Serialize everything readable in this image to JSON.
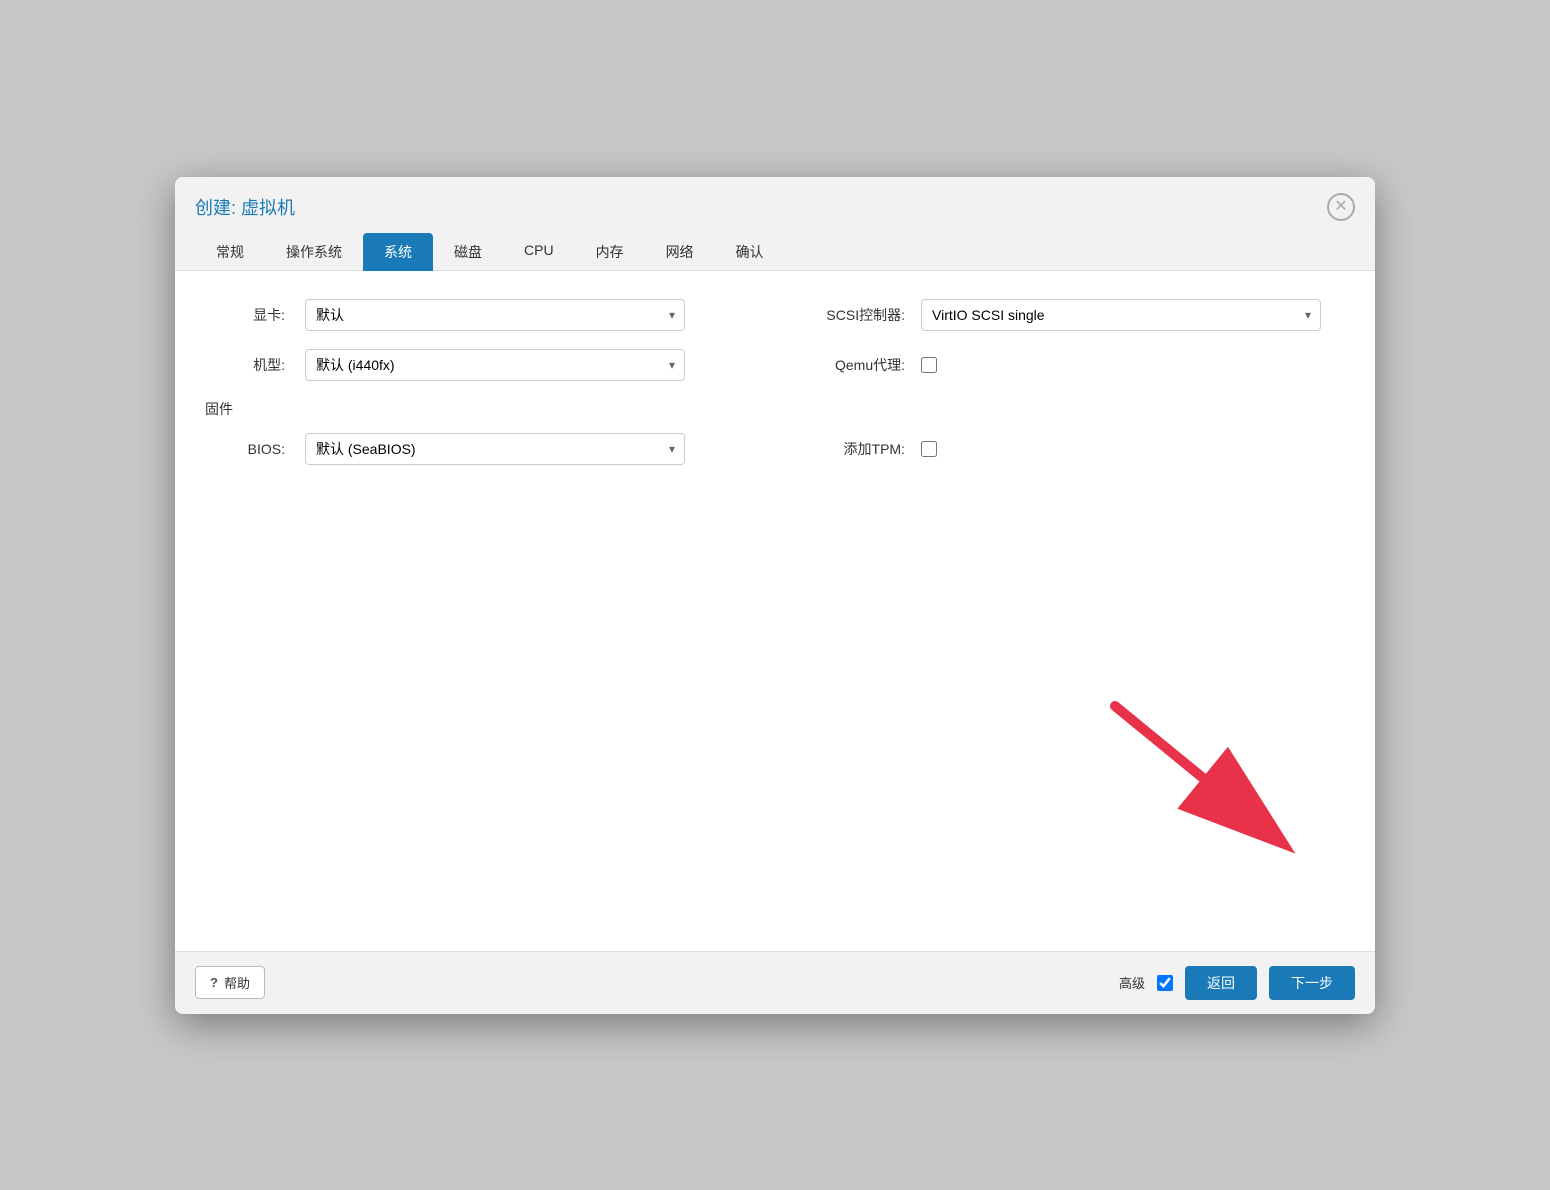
{
  "dialog": {
    "title": "创建: 虚拟机",
    "close_label": "×"
  },
  "tabs": [
    {
      "label": "常规",
      "active": false
    },
    {
      "label": "操作系统",
      "active": false
    },
    {
      "label": "系统",
      "active": true
    },
    {
      "label": "磁盘",
      "active": false
    },
    {
      "label": "CPU",
      "active": false
    },
    {
      "label": "内存",
      "active": false
    },
    {
      "label": "网络",
      "active": false
    },
    {
      "label": "确认",
      "active": false
    }
  ],
  "form": {
    "display_card_label": "显卡:",
    "display_card_value": "默认",
    "scsi_label": "SCSI控制器:",
    "scsi_value": "VirtIO SCSI single",
    "machine_type_label": "机型:",
    "machine_type_value": "默认 (i440fx)",
    "qemu_agent_label": "Qemu代理:",
    "qemu_agent_checked": false,
    "firmware_label": "固件",
    "bios_label": "BIOS:",
    "bios_value": "默认 (SeaBIOS)",
    "add_tpm_label": "添加TPM:",
    "add_tpm_checked": false
  },
  "footer": {
    "help_label": "帮助",
    "advanced_label": "高级",
    "advanced_checked": true,
    "back_label": "返回",
    "next_label": "下一步"
  }
}
